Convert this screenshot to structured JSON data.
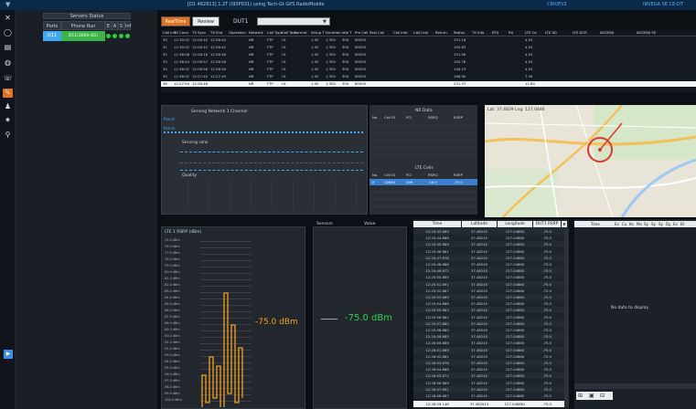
{
  "window": {
    "title": "[D1 482913] 1.2T (I93P031) using Tech-Gt GPS RadioMobile",
    "right_text_1": "CRV/EV3",
    "right_text_2": "INVEGA SE CE-DT"
  },
  "rail": {
    "items": [
      {
        "name": "close-icon",
        "glyph": "✕"
      },
      {
        "name": "record-icon",
        "glyph": "◯"
      },
      {
        "name": "list-icon",
        "glyph": "▤"
      },
      {
        "name": "globe-icon",
        "glyph": "◍"
      },
      {
        "name": "phone-icon",
        "glyph": "☏"
      },
      {
        "name": "edit-icon",
        "glyph": "✎"
      },
      {
        "name": "user-icon",
        "glyph": "♟"
      },
      {
        "name": "settings-icon",
        "glyph": "✷"
      },
      {
        "name": "pin-icon",
        "glyph": "⚲"
      }
    ],
    "play_glyph": "▶"
  },
  "left_panel": {
    "header": "Servers Status",
    "col1": "Ports",
    "col2": "Phone Run",
    "flags": [
      "E",
      "A",
      "S",
      "Inf"
    ],
    "row": {
      "port": "D11",
      "phone": "D11(3600-4G)"
    }
  },
  "toolbar": {
    "tab_realtime": "RealTime",
    "tab_review": "Review",
    "dut_label": "DUT1",
    "dut_value": ""
  },
  "table1": {
    "headers": [
      "Call Init",
      "TX Conn",
      "TX Sync",
      "TX End",
      "Operation",
      "Network",
      "Call Type",
      "Call Task",
      "Format",
      "Setup T",
      "Duration",
      "Idle T",
      "Pre Call",
      "Post Call",
      "Call Info",
      "Call Link",
      "Return",
      "Status",
      "TX Info",
      "RTX",
      "RX",
      "LTE Cd",
      "LTE SD",
      "LTE DCR",
      "WCDMA",
      "WCDMA SE"
    ],
    "rows": [
      [
        "30",
        "11:30:02",
        "12:26:45",
        "12:26:45",
        "",
        "NR",
        "FTP",
        "UL",
        "",
        "1.00",
        "1,300",
        "300",
        "60000",
        "",
        "",
        "",
        "",
        "151.16",
        "",
        "",
        "",
        "4.03",
        "",
        "",
        "",
        ""
      ],
      [
        "31",
        "11:30:02",
        "12:26:42",
        "12:26:42",
        "",
        "NR",
        "FTP",
        "UL",
        "",
        "1.00",
        "1,300",
        "300",
        "60000",
        "",
        "",
        "",
        "",
        "150.83",
        "",
        "",
        "",
        "4.03",
        "",
        "",
        "",
        ""
      ],
      [
        "32",
        "11:36:08",
        "12:26:18",
        "12:26:48",
        "",
        "NR",
        "FTP",
        "UL",
        "",
        "1.00",
        "1,300",
        "300",
        "60000",
        "",
        "",
        "",
        "",
        "151.56",
        "",
        "",
        "",
        "4.03",
        "",
        "",
        "",
        ""
      ],
      [
        "33",
        "11:36:44",
        "12:26:57",
        "12:26:58",
        "",
        "NR",
        "FTP",
        "UL",
        "",
        "1.00",
        "1,300",
        "300",
        "60000",
        "",
        "",
        "",
        "",
        "150.76",
        "",
        "",
        "",
        "4.03",
        "",
        "",
        "",
        ""
      ],
      [
        "34",
        "11:38:02",
        "12:26:58",
        "12:26:59",
        "",
        "NR",
        "FTP",
        "UL",
        "",
        "1.00",
        "1,300",
        "300",
        "60000",
        "",
        "",
        "",
        "",
        "146.23",
        "",
        "",
        "",
        "4.03",
        "",
        "",
        "",
        ""
      ],
      [
        "35",
        "11:38:02",
        "12:27:49",
        "12:27:49",
        "",
        "NR",
        "FTP",
        "UL",
        "",
        "1.00",
        "1,300",
        "300",
        "60000",
        "",
        "",
        "",
        "",
        "166.90",
        "",
        "",
        "",
        "7.26",
        "",
        "",
        "",
        ""
      ]
    ],
    "selected_row": [
      "36",
      "12:27:54",
      "12:28:46",
      "",
      "",
      "NR",
      "FTP",
      "UL",
      "",
      "1.00",
      "1,300",
      "300",
      "60000",
      "",
      "",
      "",
      "",
      "231.37",
      "",
      "",
      "",
      "11.80",
      "",
      "",
      "",
      ""
    ]
  },
  "chart_panel": {
    "label_top": "Serving Network 1 Channel",
    "label_mid": "Serving rank",
    "label_bottom": "Quality",
    "legend1": "Parcel",
    "legend2": "Parcel"
  },
  "info_panel": {
    "nr_title": "NR Data",
    "nr_headers": [
      "No.",
      "Cell ID",
      "PCI",
      "RSRQ",
      "RSRP"
    ],
    "lte_title": "LTE Cells",
    "lte_headers": [
      "No.",
      "Cell ID",
      "PCI",
      "RSRQ",
      "RSRP"
    ],
    "lte_row": [
      "0",
      "12840",
      "299",
      "-10.0",
      "-75.0"
    ]
  },
  "map": {
    "overlay_text": "Lat: 37.4829 Lng: 127.0486"
  },
  "bottom_left": {
    "title": "LTE 1 RSRP (dBm)",
    "value_text": "-75.0 dBm",
    "axis_labels": [
      "-75.0 dBm",
      "-76.0 dBm",
      "-77.0 dBm",
      "-78.0 dBm",
      "-79.0 dBm",
      "-80.0 dBm",
      "-81.0 dBm",
      "-82.0 dBm",
      "-83.0 dBm",
      "-84.0 dBm",
      "-85.0 dBm",
      "-86.0 dBm",
      "-87.0 dBm",
      "-88.0 dBm",
      "-89.0 dBm",
      "-90.0 dBm",
      "-91.0 dBm",
      "-92.0 dBm",
      "-93.0 dBm",
      "-94.0 dBm",
      "-95.0 dBm",
      "-96.0 dBm",
      "-97.0 dBm",
      "-98.0 dBm",
      "-99.0 dBm",
      "-100.0 dBm"
    ]
  },
  "bottom_mid": {
    "header1": "Sensors",
    "header2": "Value",
    "value_text": "-75.0 dBm"
  },
  "time_table": {
    "headers": [
      "Time",
      "Latitude",
      "Longitude",
      "DUT1 RSRP"
    ],
    "rows": [
      [
        "12:25:43.885",
        "37.48245",
        "127.04880",
        "-75.0"
      ],
      [
        "12:25:44.886",
        "37.48245",
        "127.04880",
        "-75.0"
      ],
      [
        "12:25:45.889",
        "37.48245",
        "127.04880",
        "-75.0"
      ],
      [
        "12:25:46.881",
        "37.48245",
        "127.04880",
        "-75.0"
      ],
      [
        "12:25:47.878",
        "37.48245",
        "127.04880",
        "-75.0"
      ],
      [
        "12:25:48.888",
        "37.48245",
        "127.04880",
        "-75.0"
      ],
      [
        "12:25:49.872",
        "37.48245",
        "127.04880",
        "-75.0"
      ],
      [
        "12:25:50.889",
        "37.48245",
        "127.04880",
        "-75.0"
      ],
      [
        "12:25:51.891",
        "37.48245",
        "127.04880",
        "-75.0"
      ],
      [
        "12:25:52.887",
        "37.48245",
        "127.04880",
        "-75.0"
      ],
      [
        "12:25:53.885",
        "37.48245",
        "127.04880",
        "-75.0"
      ],
      [
        "12:25:54.886",
        "37.48245",
        "127.04880",
        "-75.0"
      ],
      [
        "12:25:55.883",
        "37.48245",
        "127.04880",
        "-75.0"
      ],
      [
        "12:25:56.882",
        "37.48245",
        "127.04880",
        "-75.0"
      ],
      [
        "12:25:57.880",
        "37.48245",
        "127.04880",
        "-75.0"
      ],
      [
        "12:25:58.880",
        "37.48245",
        "127.04880",
        "-75.0"
      ],
      [
        "12:25:59.885",
        "37.48245",
        "127.04880",
        "-75.0"
      ],
      [
        "12:26:00.886",
        "37.48245",
        "127.04880",
        "-75.0"
      ],
      [
        "12:26:01.889",
        "37.48245",
        "127.04880",
        "-75.0"
      ],
      [
        "12:26:02.881",
        "37.48245",
        "127.04880",
        "-75.0"
      ],
      [
        "12:26:03.878",
        "37.48245",
        "127.04880",
        "-75.0"
      ],
      [
        "12:26:04.888",
        "37.48245",
        "127.04880",
        "-75.0"
      ],
      [
        "12:26:05.872",
        "37.48245",
        "127.04880",
        "-75.0"
      ],
      [
        "12:26:06.889",
        "37.48245",
        "127.04880",
        "-75.0"
      ],
      [
        "12:26:07.891",
        "37.48245",
        "127.04880",
        "-75.0"
      ],
      [
        "12:26:08.887",
        "37.48245",
        "127.04880",
        "-75.0"
      ]
    ],
    "last_row": [
      "12:26:09.146",
      "37.482913",
      "127.048861",
      "-75.0"
    ]
  },
  "right_panel": {
    "headers": [
      "Time",
      "Ev",
      "Cu",
      "Ke",
      "Me",
      "Sy",
      "Sy",
      "Sy",
      "Dy",
      "Ev",
      "Bl"
    ],
    "center_text": "No data to display"
  }
}
